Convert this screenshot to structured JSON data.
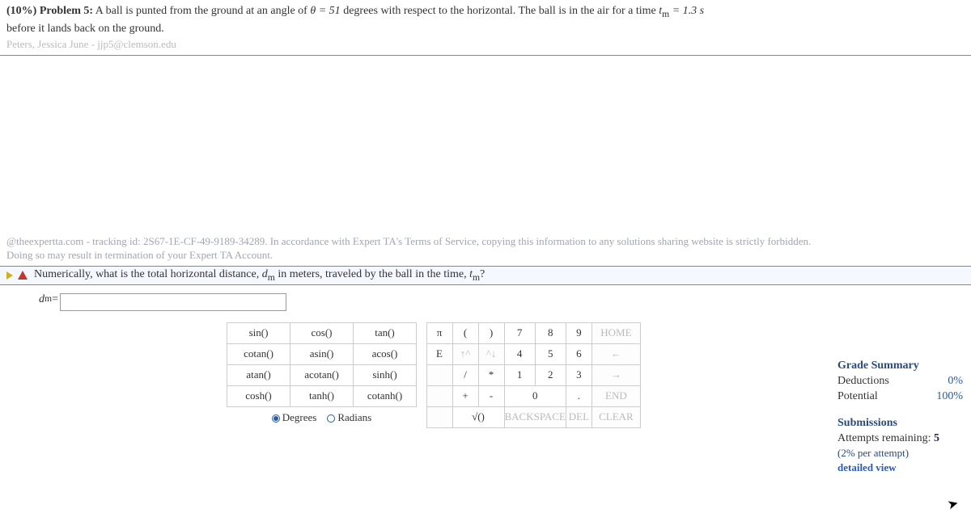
{
  "problem": {
    "label": "(10%) Problem 5:",
    "text1": "A ball is punted from the ground at an angle of ",
    "theta": "θ = 51",
    "text2": " degrees with respect to the horizontal. The ball is in the air for a time ",
    "tm_var": "t",
    "tm_sub": "m",
    "tm_eq": " = 1.3 s",
    "line2": "before it lands back on the ground.",
    "author": "Peters, Jessica June - jjp5@clemson.edu"
  },
  "tracking": {
    "line1": "@theexpertta.com - tracking id: 2S67-1E-CF-49-9189-34289. In accordance with Expert TA's Terms of Service, copying this information to any solutions sharing website is strictly forbidden.",
    "line2": "Doing so may result in termination of your Expert TA Account."
  },
  "question": {
    "text1": "Numerically, what is the total horizontal distance, ",
    "var": "d",
    "sub": "m",
    "text2": " in meters, traveled by the ball in the time, ",
    "var2": "t",
    "sub2": "m",
    "q": "?"
  },
  "answer": {
    "label_var": "d",
    "label_sub": "m",
    "label_eq": " = ",
    "value": ""
  },
  "grade": {
    "title": "Grade Summary",
    "ded_label": "Deductions",
    "ded_val": "0%",
    "pot_label": "Potential",
    "pot_val": "100%",
    "sub_title": "Submissions",
    "attempts_label": "Attempts remaining: ",
    "attempts_num": "5",
    "hint": "(2% per attempt)",
    "dv": "detailed view"
  },
  "funcs": {
    "r0": [
      "sin()",
      "cos()",
      "tan()"
    ],
    "r1": [
      "cotan()",
      "asin()",
      "acos()"
    ],
    "r2": [
      "atan()",
      "acotan()",
      "sinh()"
    ],
    "r3": [
      "cosh()",
      "tanh()",
      "cotanh()"
    ],
    "mode_deg": "Degrees",
    "mode_rad": "Radians"
  },
  "nums": {
    "r0": [
      "π",
      "(",
      ")",
      "7",
      "8",
      "9",
      "HOME"
    ],
    "r1": [
      "E",
      "↑^",
      "^↓",
      "4",
      "5",
      "6",
      "←"
    ],
    "r2": [
      "",
      "/",
      "*",
      "1",
      "2",
      "3",
      "→"
    ],
    "r3": [
      "",
      "+",
      "-",
      "0",
      "",
      ".",
      "END"
    ],
    "r4": [
      "",
      "√()",
      "BACKSPACE",
      "DEL",
      "CLEAR"
    ]
  }
}
